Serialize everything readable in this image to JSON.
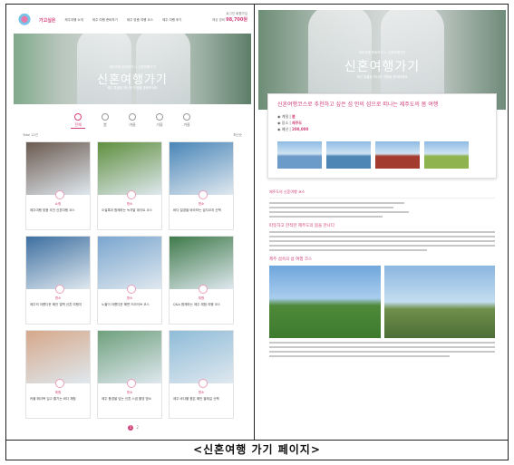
{
  "caption": "<신혼여행 가기 페이지>",
  "left": {
    "logo_text": "가고싶은",
    "nav": [
      "제주여행 소개",
      "제주 여행 준비하기",
      "제주 맞춤 여행 코스",
      "제주 여행 후기"
    ],
    "top_right": {
      "login": "로그인 회원가입",
      "price_label": "예상 경비",
      "price": "98,700원"
    },
    "hero": {
      "sub": "제주여행 준비하기 > 신혼여행가기",
      "title": "신혼여행가기",
      "desc": "제주 특별한 허니문 여행을 준비하세요"
    },
    "tabs": [
      {
        "label": "전체",
        "icon": "all-icon"
      },
      {
        "label": "봄",
        "icon": "spring-icon"
      },
      {
        "label": "여름",
        "icon": "summer-icon"
      },
      {
        "label": "가을",
        "icon": "autumn-icon"
      },
      {
        "label": "겨울",
        "icon": "winter-icon"
      }
    ],
    "filter_left": "Total 12건",
    "filter_right": "최신순",
    "cards": [
      {
        "cat": "쇼핑",
        "text": "제주여행 맞춤 추천 신혼여행 코스",
        "img": "#6b5a4f"
      },
      {
        "cat": "명소",
        "text": "오설록과 함께하는 녹차밭 데이트 코스",
        "img": "#5f8f3e"
      },
      {
        "cat": "명소",
        "text": "바다 절경을 바라보는 섭지코지 산책",
        "img": "#4a86b8"
      },
      {
        "cat": "명소",
        "text": "제주의 아름다운 해안 절벽 신혼 여행지",
        "img": "#3d6fa0"
      },
      {
        "cat": "명소",
        "text": "노을이 아름다운 해변 드라이브 코스",
        "img": "#7aa6cf"
      },
      {
        "cat": "체험",
        "text": "Q&A 함께하는 제주 체험 여행 코스",
        "img": "#3f7a4a"
      },
      {
        "cat": "체험",
        "text": "커플 해녀복 입고 즐기는 바다 체험",
        "img": "#d6a88a"
      },
      {
        "cat": "명소",
        "text": "제주 풍경을 담는 신혼 스냅 촬영 명소",
        "img": "#6fa07d"
      },
      {
        "cat": "명소",
        "text": "제주 바다를 품은 해안 올레길 산책",
        "img": "#8fbcd8"
      }
    ],
    "pager": [
      "1",
      "2"
    ]
  },
  "right": {
    "hero": {
      "sub": "제주여행 준비하기 > 신혼여행가기",
      "title": "신혼여행가기",
      "desc": "제주 특별한 허니문 여행을 준비하세요"
    },
    "detail": {
      "title": "신혼여행코스로 추천하고 싶은 섬 안의 섬으로 떠나는 제주도의 봄 여행",
      "meta": [
        {
          "label": "계절",
          "value": "봄"
        },
        {
          "label": "장소",
          "value": "제주도"
        },
        {
          "label": "예산",
          "value": "200,000"
        }
      ],
      "thumb_colors": [
        "#6c9ac9",
        "#4e86b5",
        "#a33b2e",
        "#8fb34f"
      ]
    },
    "section1_title": "제주도의 신혼여행 코스",
    "section2_title": "따뜻하고 한적한 제주도의 봄을 만나다",
    "section3_title": "제주 섬속의 섬 여행 코스"
  }
}
